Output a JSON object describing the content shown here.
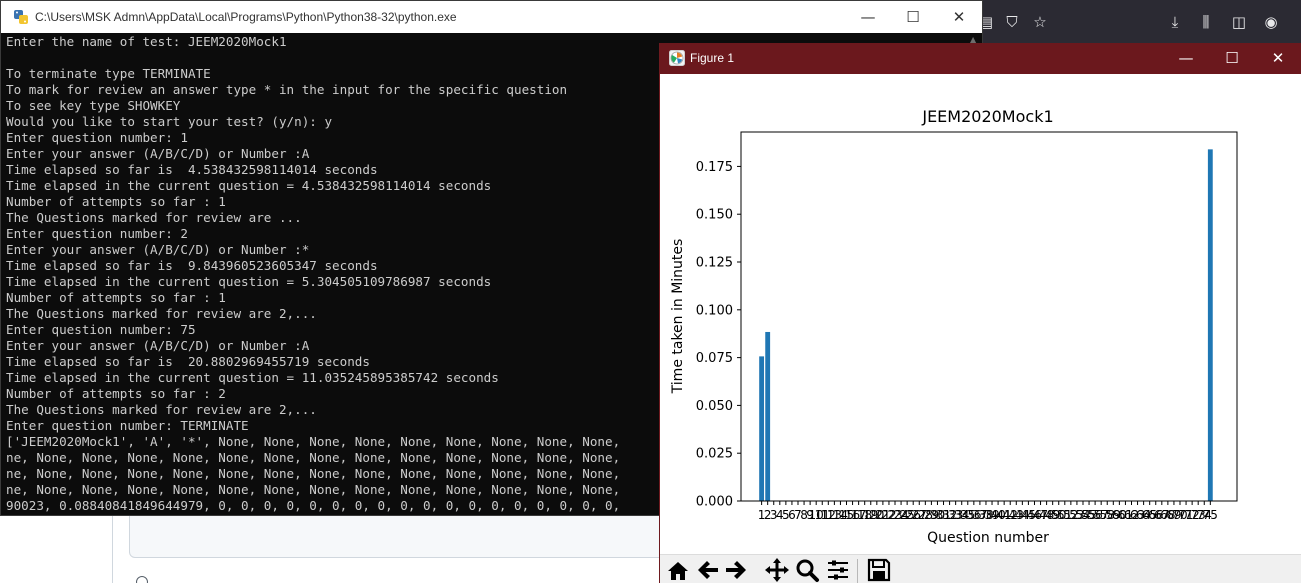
{
  "console": {
    "title": "C:\\Users\\MSK Admn\\AppData\\Local\\Programs\\Python\\Python38-32\\python.exe",
    "lines": [
      "Enter the name of test: JEEM2020Mock1",
      "",
      "To terminate type TERMINATE",
      "To mark for review an answer type * in the input for the specific question",
      "To see key type SHOWKEY",
      "Would you like to start your test? (y/n): y",
      "Enter question number: 1",
      "Enter your answer (A/B/C/D) or Number :A",
      "Time elapsed so far is  4.538432598114014 seconds",
      "Time elapsed in the current question = 4.538432598114014 seconds",
      "Number of attempts so far : 1",
      "The Questions marked for review are ...",
      "Enter question number: 2",
      "Enter your answer (A/B/C/D) or Number :*",
      "Time elapsed so far is  9.843960523605347 seconds",
      "Time elapsed in the current question = 5.304505109786987 seconds",
      "Number of attempts so far : 1",
      "The Questions marked for review are 2,...",
      "Enter question number: 75",
      "Enter your answer (A/B/C/D) or Number :A",
      "Time elapsed so far is  20.8802969455719 seconds",
      "Time elapsed in the current question = 11.035245895385742 seconds",
      "Number of attempts so far : 2",
      "The Questions marked for review are 2,...",
      "Enter question number: TERMINATE",
      "['JEEM2020Mock1', 'A', '*', None, None, None, None, None, None, None, None, None,",
      "ne, None, None, None, None, None, None, None, None, None, None, None, None, None,",
      "ne, None, None, None, None, None, None, None, None, None, None, None, None, None,",
      "ne, None, None, None, None, None, None, None, None, None, None, None, None, None,",
      "90023, 0.08840841849644979, 0, 0, 0, 0, 0, 0, 0, 0, 0, 0, 0, 0, 0, 0, 0, 0, 0, 0,"
    ]
  },
  "figure": {
    "title": "Figure 1",
    "toolbar": [
      "home-icon",
      "back-arrow-icon",
      "forward-arrow-icon",
      "pan-icon",
      "zoom-icon",
      "subplots-icon",
      "save-icon"
    ]
  },
  "chart_data": {
    "type": "bar",
    "title": "JEEM2020Mock1",
    "xlabel": "Question number",
    "ylabel": "Time taken in Minutes",
    "x": [
      1,
      2,
      3,
      4,
      5,
      6,
      7,
      8,
      9,
      10,
      11,
      12,
      13,
      14,
      15,
      16,
      17,
      18,
      19,
      20,
      21,
      22,
      23,
      24,
      25,
      26,
      27,
      28,
      29,
      30,
      31,
      32,
      33,
      34,
      35,
      36,
      37,
      38,
      39,
      40,
      41,
      42,
      43,
      44,
      45,
      46,
      47,
      48,
      49,
      50,
      51,
      52,
      53,
      54,
      55,
      56,
      57,
      58,
      59,
      60,
      61,
      62,
      63,
      64,
      65,
      66,
      67,
      68,
      69,
      70,
      71,
      72,
      73,
      74,
      75
    ],
    "values": [
      0.0756405433,
      0.0884084185,
      0,
      0,
      0,
      0,
      0,
      0,
      0,
      0,
      0,
      0,
      0,
      0,
      0,
      0,
      0,
      0,
      0,
      0,
      0,
      0,
      0,
      0,
      0,
      0,
      0,
      0,
      0,
      0,
      0,
      0,
      0,
      0,
      0,
      0,
      0,
      0,
      0,
      0,
      0,
      0,
      0,
      0,
      0,
      0,
      0,
      0,
      0,
      0,
      0,
      0,
      0,
      0,
      0,
      0,
      0,
      0,
      0,
      0,
      0,
      0,
      0,
      0,
      0,
      0,
      0,
      0,
      0,
      0,
      0,
      0,
      0,
      0,
      0.1839207649
    ],
    "yticks": [
      "0.000",
      "0.025",
      "0.050",
      "0.075",
      "0.100",
      "0.125",
      "0.150",
      "0.175"
    ],
    "ylim": [
      0,
      0.193
    ],
    "xlim": [
      -2.4,
      79.4
    ],
    "grid": false,
    "bar_color": "#1f77b4"
  }
}
